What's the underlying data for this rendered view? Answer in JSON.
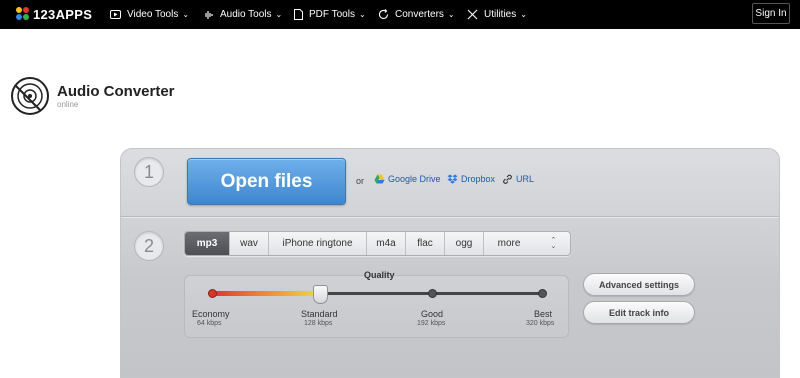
{
  "nav": {
    "logo_text": "123APPS",
    "items": [
      {
        "label": "Video Tools",
        "icon": "video-icon"
      },
      {
        "label": "Audio Tools",
        "icon": "waveform-icon"
      },
      {
        "label": "PDF Tools",
        "icon": "document-icon"
      },
      {
        "label": "Converters",
        "icon": "convert-icon"
      },
      {
        "label": "Utilities",
        "icon": "tools-icon"
      }
    ],
    "sign_in": "Sign In"
  },
  "header": {
    "title": "Audio Converter",
    "subtitle": "online"
  },
  "step1": {
    "number": "1",
    "open_files": "Open files",
    "or": "or",
    "sources": [
      {
        "label": "Google Drive",
        "icon": "google-drive-icon"
      },
      {
        "label": "Dropbox",
        "icon": "dropbox-icon"
      },
      {
        "label": "URL",
        "icon": "link-icon"
      }
    ]
  },
  "step2": {
    "number": "2",
    "formats": [
      "mp3",
      "wav",
      "iPhone ringtone",
      "m4a",
      "flac",
      "ogg",
      "more"
    ],
    "selected_format": "mp3",
    "quality": {
      "label": "Quality",
      "levels": [
        {
          "name": "Economy",
          "kbps": "64 kbps"
        },
        {
          "name": "Standard",
          "kbps": "128 kbps"
        },
        {
          "name": "Good",
          "kbps": "192 kbps"
        },
        {
          "name": "Best",
          "kbps": "320 kbps"
        }
      ],
      "selected": "Standard"
    },
    "buttons": {
      "advanced": "Advanced settings",
      "edit_track": "Edit track info"
    }
  },
  "colors": {
    "nav_bg": "#000000",
    "open_button": "#4b95dc",
    "link": "#1f5aa6",
    "logo_dots": [
      "#f6c21c",
      "#e8322b",
      "#2f8ae5",
      "#2fb34a"
    ]
  }
}
